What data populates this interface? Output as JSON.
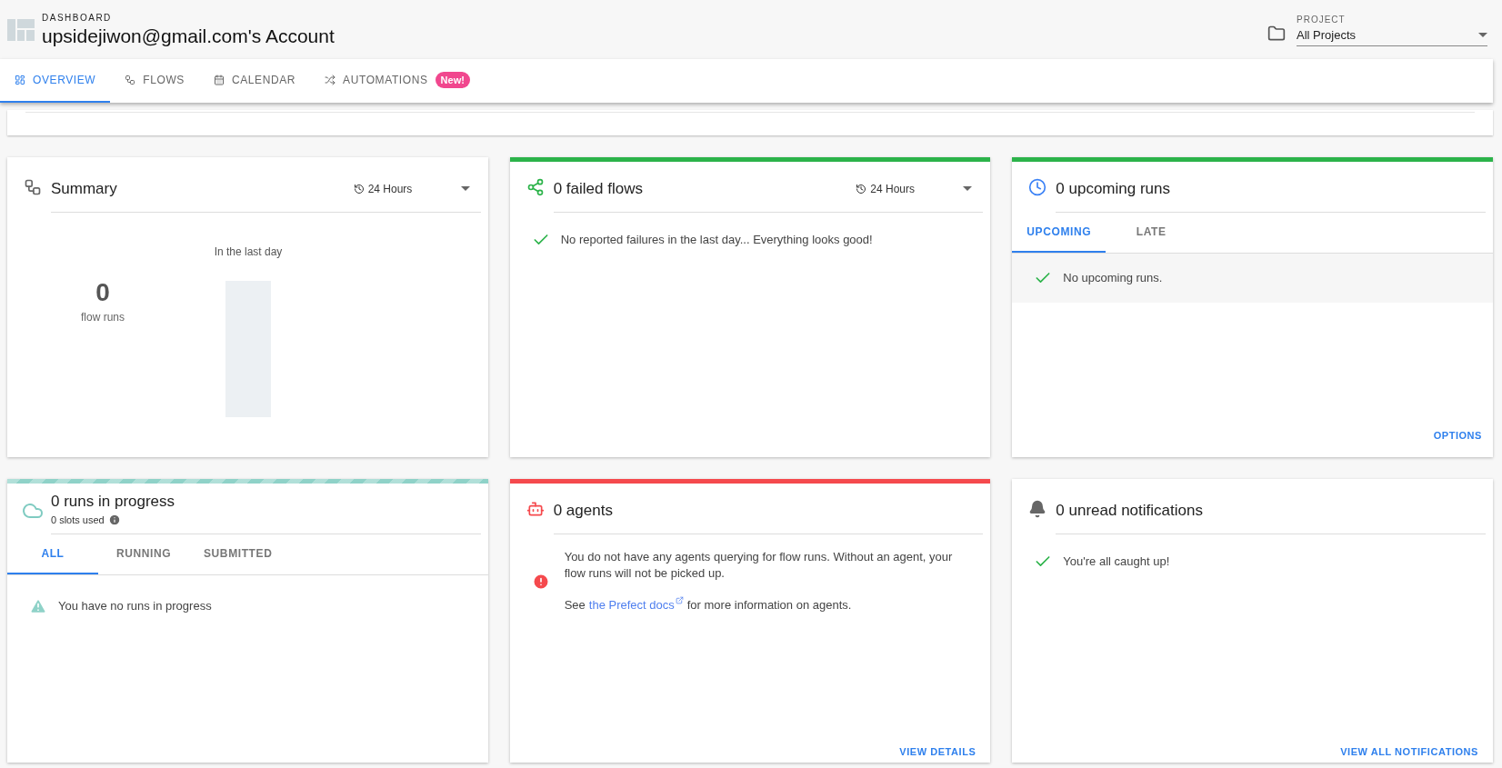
{
  "header": {
    "section": "DASHBOARD",
    "title": "upsidejiwon@gmail.com's Account",
    "project": {
      "label": "PROJECT",
      "value": "All Projects"
    }
  },
  "tabs": [
    {
      "label": "OVERVIEW",
      "selected": true
    },
    {
      "label": "FLOWS",
      "selected": false
    },
    {
      "label": "CALENDAR",
      "selected": false
    },
    {
      "label": "AUTOMATIONS",
      "selected": false,
      "badge": "New!"
    }
  ],
  "cards": [
    {
      "kind": "summary",
      "title": "Summary",
      "range": "24 Hours",
      "caption": "In the last day",
      "count": "0",
      "count_label": "flow runs"
    },
    {
      "kind": "failed",
      "color": "#2cb34a",
      "title": "0 failed flows",
      "range": "24 Hours",
      "message": "No reported failures in the last day... Everything looks good!"
    },
    {
      "kind": "upcoming",
      "color": "#2cb34a",
      "title": "0 upcoming runs",
      "tabs": [
        {
          "label": "UPCOMING",
          "selected": true
        },
        {
          "label": "LATE",
          "selected": false
        }
      ],
      "message": "No upcoming runs.",
      "action": "OPTIONS"
    },
    {
      "kind": "in_progress",
      "color": "#8fd2c8",
      "striped": true,
      "title": "0 runs in progress",
      "subtitle": "0 slots used",
      "tabs": [
        {
          "label": "ALL",
          "selected": true
        },
        {
          "label": "RUNNING",
          "selected": false
        },
        {
          "label": "SUBMITTED",
          "selected": false
        }
      ],
      "message": "You have no runs in progress"
    },
    {
      "kind": "agents",
      "color": "#f5494d",
      "title": "0 agents",
      "message": "You do not have any agents querying for flow runs. Without an agent, your flow runs will not be picked up.",
      "note_before": "See",
      "link": "the Prefect docs",
      "note_after": "for more information on agents.",
      "action": "VIEW DETAILS"
    },
    {
      "kind": "notifications",
      "title": "0 unread notifications",
      "message": "You're all caught up!",
      "action": "VIEW ALL NOTIFICATIONS"
    }
  ]
}
